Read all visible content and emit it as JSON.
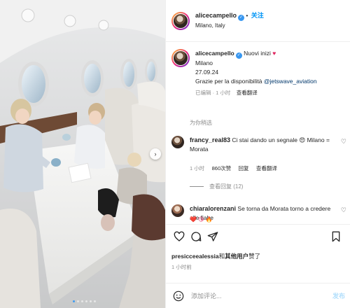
{
  "post": {
    "username": "alicecampello",
    "follow_label": "关注",
    "location": "Milano, Italy",
    "verified_glyph": "✓"
  },
  "photo": {
    "next_glyph": "›",
    "slide_count": 6,
    "active_slide": 1
  },
  "caption": {
    "username": "alicecampello",
    "text_line1": "Nuovi inizi",
    "heart": "♥",
    "city": "Milano",
    "date": "27.09.24",
    "thanks_text": "Grazie per la disponibilità",
    "mention": "@jetswave_aviation",
    "edited_label": "已编辑 · 1 小时",
    "see_translation": "查看翻译"
  },
  "translate_label": "为你稍选",
  "comments": [
    {
      "username": "francy_real83",
      "text": "Ci stai dando un segnale 😍 Milano = Morata",
      "time": "1 小时",
      "likes": "860次赞",
      "reply": "回复",
      "translate": "查看翻译"
    },
    {
      "username": "chiaralorenzani",
      "text": "Se torna da Morata torno a credere alle fiabe",
      "emoji": "❤️ 😘 🔥"
    }
  ],
  "replies_label": "查看回复 (12)",
  "likes_line": {
    "user": "presicceealessia",
    "connector": "和",
    "others": "其他用户",
    "suffix": "赞了"
  },
  "time_ago": "1 小时前",
  "comment_input": {
    "placeholder": "添加评论...",
    "post_label": "发布"
  },
  "icons": [
    "verified-icon",
    "next-arrow-icon",
    "heart-outline-icon",
    "comment-icon",
    "share-icon",
    "bookmark-icon",
    "smile-icon"
  ],
  "colors": {
    "accent": "#0095f6",
    "heart": "#e0245e",
    "mention": "#00376b",
    "muted": "#8e8e8e"
  }
}
